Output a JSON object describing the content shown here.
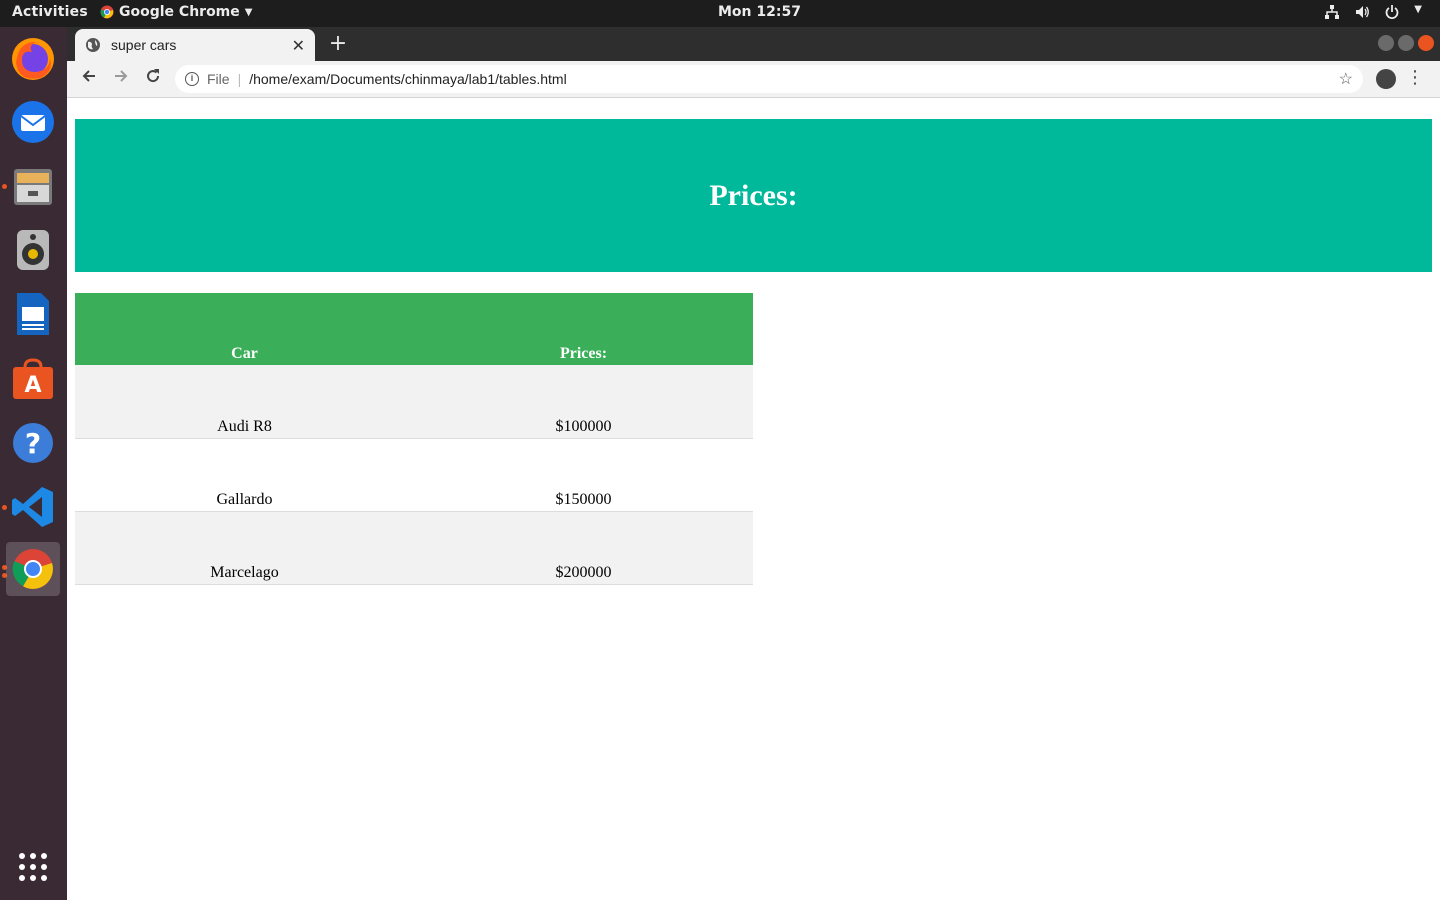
{
  "system": {
    "activities": "Activities",
    "app_menu": "Google Chrome",
    "clock": "Mon 12:57"
  },
  "browser": {
    "tab_title": "super cars",
    "url_scheme": "File",
    "url": "/home/exam/Documents/chinmaya/lab1/tables.html"
  },
  "page": {
    "heading": "Prices:",
    "table": {
      "headers": [
        "Car",
        "Prices:"
      ],
      "rows": [
        [
          "Audi R8",
          "$100000"
        ],
        [
          "Gallardo",
          "$150000"
        ],
        [
          "Marcelago",
          "$200000"
        ]
      ]
    }
  },
  "colors": {
    "banner": "#00b99b",
    "table_header": "#3aae58",
    "row_alt": "#f2f2f2"
  }
}
